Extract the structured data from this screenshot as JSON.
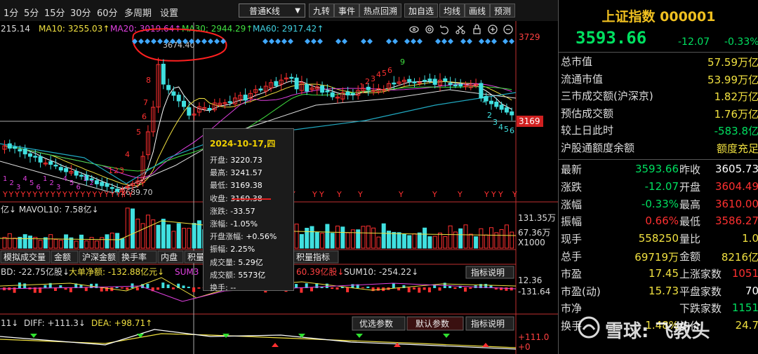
{
  "toolbar": {
    "items": [
      "1分",
      "5分",
      "15分",
      "30分",
      "60分",
      "多周期",
      "设置"
    ],
    "kline_type": "普通K线",
    "buttons": [
      "九转",
      "事件",
      "热点回溯",
      "加自选",
      "均线",
      "画线",
      "预测"
    ]
  },
  "main": {
    "ma_legend": {
      "first": "215.14",
      "ma10": "MA10: 3255.03↑",
      "ma20": "MA20: 3019.64↑",
      "ma30": "MA30: 2944.29↑",
      "ma60": "MA60: 2917.42↑"
    },
    "price_labels": {
      "high": "3729",
      "current": "3169"
    },
    "peak_label": "3674.40",
    "low_label": "2689.70",
    "nine_labels": [
      "8",
      "7",
      "6",
      "5",
      "4",
      "3",
      "2",
      "1",
      "9",
      "1",
      "2",
      "3",
      "4",
      "5",
      "6",
      "1",
      "2",
      "3",
      "4",
      "5",
      "6"
    ],
    "volume_legend": "亿↓  MAVOL10: 7.58亿↓",
    "volume_axis": [
      "131.35万",
      "67.36万",
      "X1000"
    ],
    "indicator_tabs": [
      "模拟成交量",
      "金额",
      "沪深金额",
      "换手率",
      "内盘",
      "积量指标"
    ],
    "fund_legend": {
      "bd": "BD: -22.75亿股↓",
      "big": "大单净额: -132.88亿元↓",
      "sum3": "SUM3",
      "mid": "60.39亿股↓",
      "sum10": "SUM10: -254.22↓"
    },
    "fund_axis": [
      "12.36",
      "-131.64"
    ],
    "fund_button": "指标说明",
    "macd_legend": {
      "prefix": "11↓",
      "diff": "DIFF: +111.3↓",
      "dea": "DEA: +98.71↑"
    },
    "macd_buttons": [
      "优选参数",
      "默认参数",
      "指标说明"
    ],
    "macd_axis": [
      "+111.0",
      "+0"
    ],
    "signals": [
      "Y",
      "Y",
      "Y",
      "Y",
      "Y",
      "Y",
      "Y",
      "Y",
      "Y",
      "Y",
      "Y",
      "Y",
      "Y",
      "Y"
    ]
  },
  "tooltip": {
    "date": "2024-10-17,四",
    "rows": [
      {
        "k": "开盘:",
        "v": "3220.73"
      },
      {
        "k": "最高:",
        "v": "3241.57"
      },
      {
        "k": "最低:",
        "v": "3169.38"
      },
      {
        "k": "收盘:",
        "v": "3169.38"
      },
      {
        "k": "涨跌:",
        "v": "-33.57"
      },
      {
        "k": "涨幅:",
        "v": "-1.05%"
      },
      {
        "k": "开盘涨幅:",
        "v": "+0.56%"
      },
      {
        "k": "振幅:",
        "v": "2.25%"
      },
      {
        "k": "成交量:",
        "v": "5.29亿"
      },
      {
        "k": "成交额:",
        "v": "5573亿"
      },
      {
        "k": "换手:",
        "v": "--"
      }
    ]
  },
  "quote": {
    "title": "上证指数 000001",
    "price": "3593.66",
    "change": "-12.07",
    "pct": "-0.33%",
    "stats": [
      {
        "label": "总市值",
        "value": "57.59万亿"
      },
      {
        "label": "流通市值",
        "value": "53.99万亿"
      },
      {
        "label": "三市成交额(沪深京)",
        "value": "1.82万亿"
      },
      {
        "label": "预估成交额",
        "value": "1.76万亿"
      },
      {
        "label": "较上日此时",
        "value": "-583.8亿"
      },
      {
        "label": "沪股通额度余额",
        "value": "额度充足"
      }
    ],
    "pairs": [
      {
        "l1": "最新",
        "v1": "3593.66",
        "l2": "昨收",
        "v2": "3605.73"
      },
      {
        "l1": "涨跌",
        "v1": "-12.07",
        "l2": "开盘",
        "v2": "3604.49"
      },
      {
        "l1": "涨幅",
        "v1": "-0.33%",
        "l2": "最高",
        "v2": "3610.00"
      },
      {
        "l1": "振幅",
        "v1": "0.66%",
        "l2": "最低",
        "v2": "3586.27"
      },
      {
        "l1": "现手",
        "v1": "558250",
        "l2": "量比",
        "v2": "1.0"
      },
      {
        "l1": "总手",
        "v1": "69719万",
        "l2": "金额",
        "v2": "8216亿"
      },
      {
        "l1": "市盈",
        "v1": "17.45",
        "l2": "上涨家数",
        "v2": "1051"
      },
      {
        "l1": "市盈(动)",
        "v1": "15.73",
        "l2": "平盘家数",
        "v2": "70"
      },
      {
        "l1": "市净",
        "v1": "",
        "l2": "下跌家数",
        "v2": "1151"
      },
      {
        "l1": "换手",
        "v1": "1.48%",
        "l2": "均价",
        "v2": "24.7"
      }
    ]
  },
  "watermark": "雪球: 飞教头",
  "colors": {
    "up": "#ff3030",
    "down": "#40e0e0",
    "accent": "#f0c020",
    "green": "#00e060"
  }
}
